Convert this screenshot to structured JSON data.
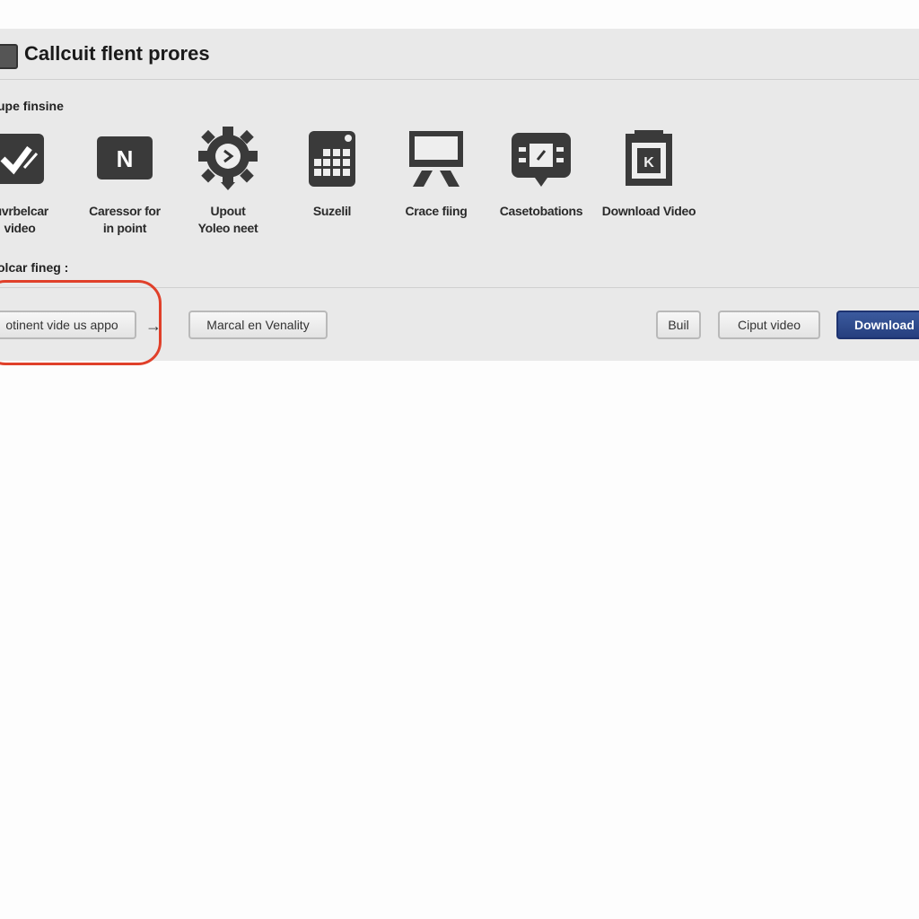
{
  "window": {
    "title": "Callcuit flent prores"
  },
  "sections": {
    "tools_label": "upe finsine",
    "actions_label": "olcar fineg :"
  },
  "tools": [
    {
      "icon": "checkmark-icon",
      "label_line1": "Iuvrbelcar",
      "label_line2": "video"
    },
    {
      "icon": "n-letter-icon",
      "label_line1": "Caressor for",
      "label_line2": "in point"
    },
    {
      "icon": "gear-play-icon",
      "label_line1": "Upout",
      "label_line2": "Yoleo neet"
    },
    {
      "icon": "grid-calculator-icon",
      "label_line1": "Suzelil",
      "label_line2": ""
    },
    {
      "icon": "monitor-stand-icon",
      "label_line1": "Crace fiing",
      "label_line2": ""
    },
    {
      "icon": "film-speech-icon",
      "label_line1": "Casetobations",
      "label_line2": ""
    },
    {
      "icon": "download-frame-icon",
      "label_line1": "Download Video",
      "label_line2": ""
    }
  ],
  "actions": {
    "step1": "otinent vide us appo",
    "arrow": "→",
    "step2": "Marcal en Venality",
    "build": "Buil",
    "output": "Ciput video",
    "download": "Download"
  },
  "colors": {
    "highlight": "#e0402a",
    "primary": "#2c4586",
    "panel": "#e9e9e9"
  }
}
